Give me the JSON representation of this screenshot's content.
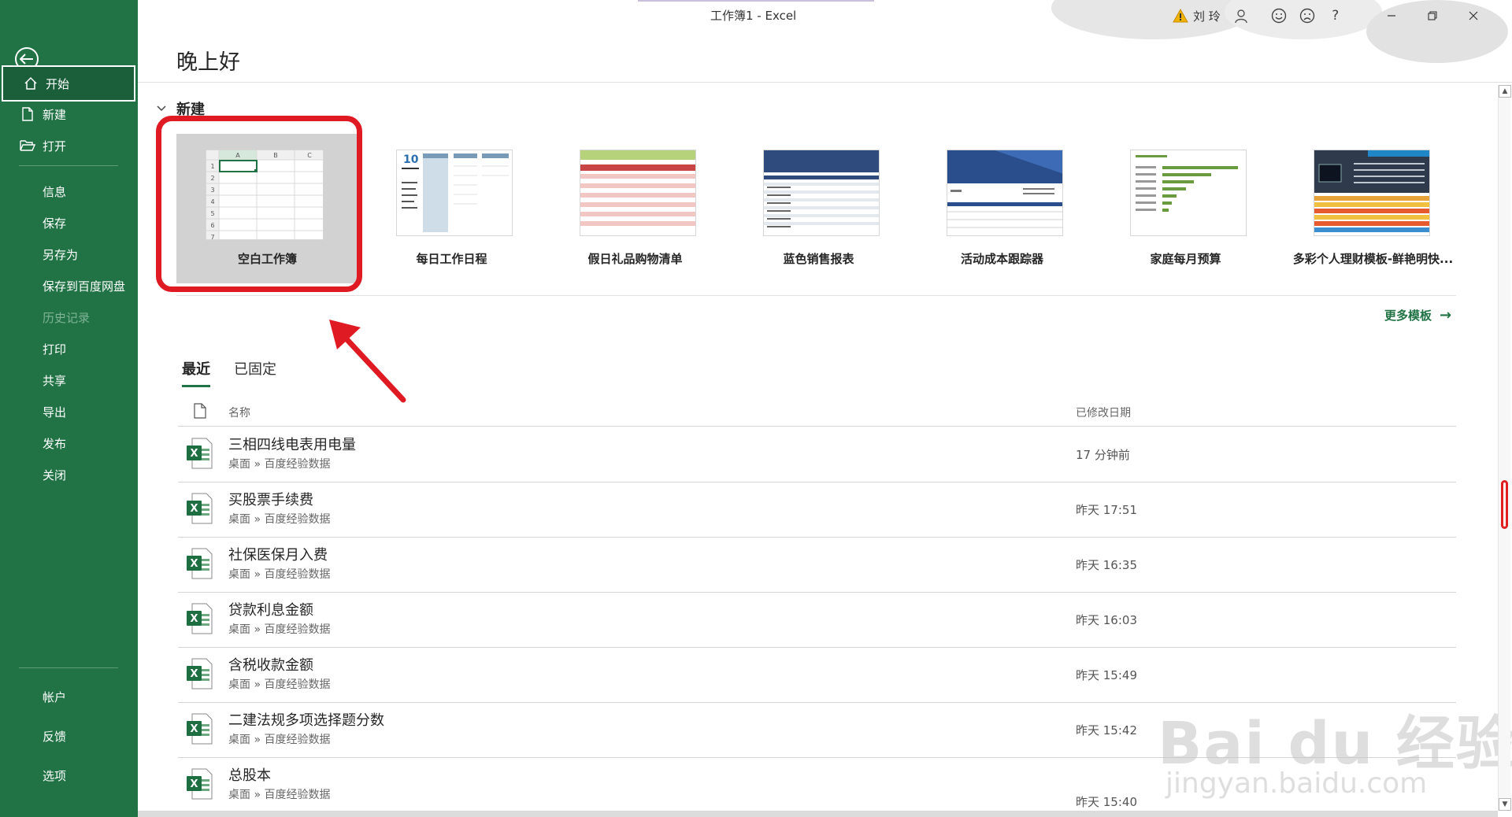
{
  "window": {
    "title": "工作簿1  -  Excel",
    "user": "刘 玲"
  },
  "sidebar": {
    "items": [
      {
        "label": "开始",
        "icon": "home-icon"
      },
      {
        "label": "新建",
        "icon": "new-file-icon"
      },
      {
        "label": "打开",
        "icon": "folder-open-icon"
      },
      {
        "label": "信息"
      },
      {
        "label": "保存"
      },
      {
        "label": "另存为"
      },
      {
        "label": "保存到百度网盘"
      },
      {
        "label": "历史记录"
      },
      {
        "label": "打印"
      },
      {
        "label": "共享"
      },
      {
        "label": "导出"
      },
      {
        "label": "发布"
      },
      {
        "label": "关闭"
      },
      {
        "label": "帐户"
      },
      {
        "label": "反馈"
      },
      {
        "label": "选项"
      }
    ]
  },
  "main": {
    "greeting": "晚上好",
    "new_section": {
      "title": "新建",
      "more_templates": "更多模板"
    },
    "templates": [
      {
        "label": "空白工作簿",
        "cols": [
          "A",
          "B",
          "C"
        ],
        "rows": [
          "1",
          "2",
          "3",
          "4",
          "5",
          "6",
          "7"
        ]
      },
      {
        "label": "每日工作日程",
        "big_number": "10"
      },
      {
        "label": "假日礼品购物清单"
      },
      {
        "label": "蓝色销售报表"
      },
      {
        "label": "活动成本跟踪器"
      },
      {
        "label": "家庭每月预算"
      },
      {
        "label": "多彩个人理财模板-鲜艳明快..."
      }
    ],
    "tabs": [
      {
        "label": "最近"
      },
      {
        "label": "已固定"
      }
    ],
    "list_header": {
      "name": "名称",
      "date": "已修改日期"
    },
    "recent_files": [
      {
        "name": "三相四线电表用电量",
        "path": "桌面 » 百度经验数据",
        "date": "17 分钟前"
      },
      {
        "name": "买股票手续费",
        "path": "桌面 » 百度经验数据",
        "date": "昨天 17:51"
      },
      {
        "name": "社保医保月入费",
        "path": "桌面 » 百度经验数据",
        "date": "昨天 16:35"
      },
      {
        "name": "贷款利息金额",
        "path": "桌面 » 百度经验数据",
        "date": "昨天 16:03"
      },
      {
        "name": "含税收款金额",
        "path": "桌面 » 百度经验数据",
        "date": "昨天 15:49"
      },
      {
        "name": "二建法规多项选择题分数",
        "path": "桌面 » 百度经验数据",
        "date": "昨天 15:42"
      },
      {
        "name": "总股本",
        "path": "桌面 » 百度经验数据",
        "date": "昨天 15:40"
      }
    ]
  },
  "watermark": {
    "text": "Bai du 经验",
    "sub": "jingyan.baidu.com"
  },
  "colors": {
    "accent": "#217346",
    "highlight": "#e01a22"
  }
}
